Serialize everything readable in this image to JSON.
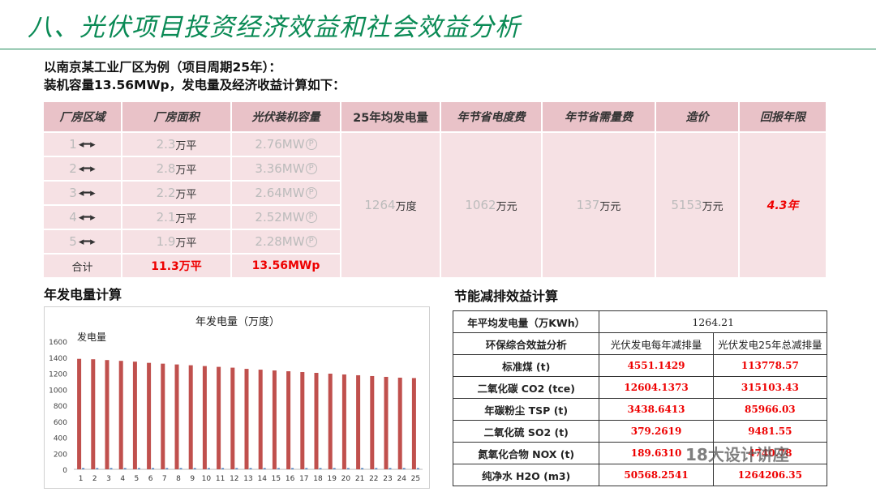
{
  "slide": {
    "title": "八、光伏项目投资经济效益和社会效益分析",
    "intro_line1": "以南京某工业厂区为例（项目周期25年）：",
    "intro_line2": "装机容量13.56MWp，发电量及经济收益计算如下："
  },
  "main_table": {
    "headers": [
      "厂房区域",
      "厂房面积",
      "光伏装机容量",
      "25年均发电量",
      "年节省电度费",
      "年节省需量费",
      "造价",
      "回报年限"
    ],
    "rows": [
      {
        "area_no": "1",
        "arrow": "◂━▸",
        "area": "2.3",
        "area_unit": "万平",
        "capacity": "2.76MW",
        "cap_p": "P"
      },
      {
        "area_no": "2",
        "arrow": "◂━▸",
        "area": "2.8",
        "area_unit": "万平",
        "capacity": "3.36MW",
        "cap_p": "P"
      },
      {
        "area_no": "3",
        "arrow": "◂━▸",
        "area": "2.2",
        "area_unit": "万平",
        "capacity": "2.64MW",
        "cap_p": "P"
      },
      {
        "area_no": "4",
        "arrow": "◂━▸",
        "area": "2.1",
        "area_unit": "万平",
        "capacity": "2.52MW",
        "cap_p": "P"
      },
      {
        "area_no": "5",
        "arrow": "◂━▸",
        "area": "1.9",
        "area_unit": "万平",
        "capacity": "2.28MW",
        "cap_p": "P"
      }
    ],
    "total": {
      "label": "合计",
      "area": "11.3万平",
      "capacity": "13.56MWp"
    },
    "generation": {
      "num": "1264",
      "unit": "万度"
    },
    "elec_saving": {
      "num": "1062",
      "unit": "万元"
    },
    "demand_saving": {
      "num": "137",
      "unit": "万元"
    },
    "cost": {
      "num": "5153",
      "unit": "万元"
    },
    "payback": "4.3年"
  },
  "chart_section_title": "年发电量计算",
  "energy_section_title": "节能减排效益计算",
  "chart_data": {
    "type": "bar",
    "title": "年发电量（万度）",
    "ylabel": "发电量",
    "ylim": [
      0,
      1600
    ],
    "yticks": [
      "0",
      "200",
      "400",
      "600",
      "800",
      "1000",
      "1200",
      "1400",
      "1600"
    ],
    "categories": [
      "1",
      "2",
      "3",
      "4",
      "5",
      "6",
      "7",
      "8",
      "9",
      "10",
      "11",
      "12",
      "13",
      "14",
      "15",
      "16",
      "17",
      "18",
      "19",
      "20",
      "21",
      "22",
      "23",
      "24",
      "25"
    ],
    "values": [
      1380,
      1375,
      1365,
      1355,
      1345,
      1330,
      1320,
      1310,
      1300,
      1290,
      1280,
      1270,
      1255,
      1245,
      1235,
      1225,
      1215,
      1205,
      1195,
      1185,
      1175,
      1165,
      1155,
      1145,
      1140
    ],
    "colors": {
      "bar": "#c0504d",
      "minor": "#4f81bd"
    }
  },
  "energy_table": {
    "avg_label": "年平均发电量（万KWh）",
    "avg_value": "1264.21",
    "header": [
      "环保综合效益分析",
      "光伏发电每年减排量",
      "光伏发电25年总减排量"
    ],
    "rows": [
      {
        "label": "标准煤   (t)",
        "annual": "4551.1429",
        "total": "113778.57"
      },
      {
        "label": "二氧化碳  CO2 (tce)",
        "annual": "12604.1373",
        "total": "315103.43"
      },
      {
        "label": "年碳粉尘  TSP (t)",
        "annual": "3438.6413",
        "total": "85966.03"
      },
      {
        "label": "二氧化硫  SO2 (t)",
        "annual": "379.2619",
        "total": "9481.55"
      },
      {
        "label": "氮氧化合物  NOX (t)",
        "annual": "189.6310",
        "total": "4740.78"
      },
      {
        "label": "纯净水  H2O (m3)",
        "annual": "50568.2541",
        "total": "1264206.35"
      }
    ]
  },
  "watermark": "18大设计讲座"
}
